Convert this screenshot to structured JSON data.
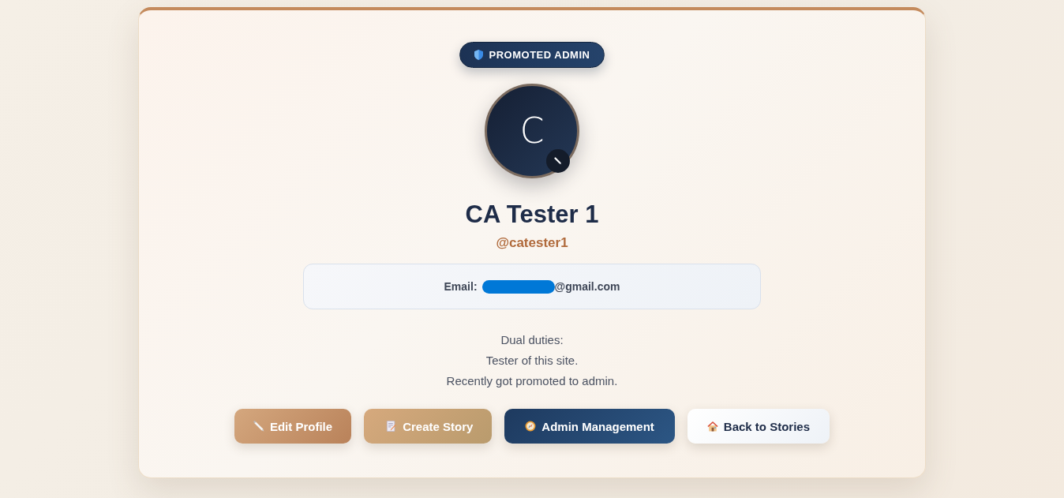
{
  "badge": {
    "label": "PROMOTED ADMIN"
  },
  "profile": {
    "avatar_initial": "C",
    "name": "CA Tester 1",
    "username": "@catester1"
  },
  "email": {
    "label": "Email:",
    "redacted": true,
    "domain": "@gmail.com"
  },
  "bio": [
    "Dual duties:",
    "Tester of this site.",
    "Recently got promoted to admin."
  ],
  "buttons": [
    {
      "label": "Edit Profile",
      "kind": "edit"
    },
    {
      "label": "Create Story",
      "kind": "create"
    },
    {
      "label": "Admin Management",
      "kind": "admin"
    },
    {
      "label": "Back to Stories",
      "kind": "back"
    }
  ]
}
